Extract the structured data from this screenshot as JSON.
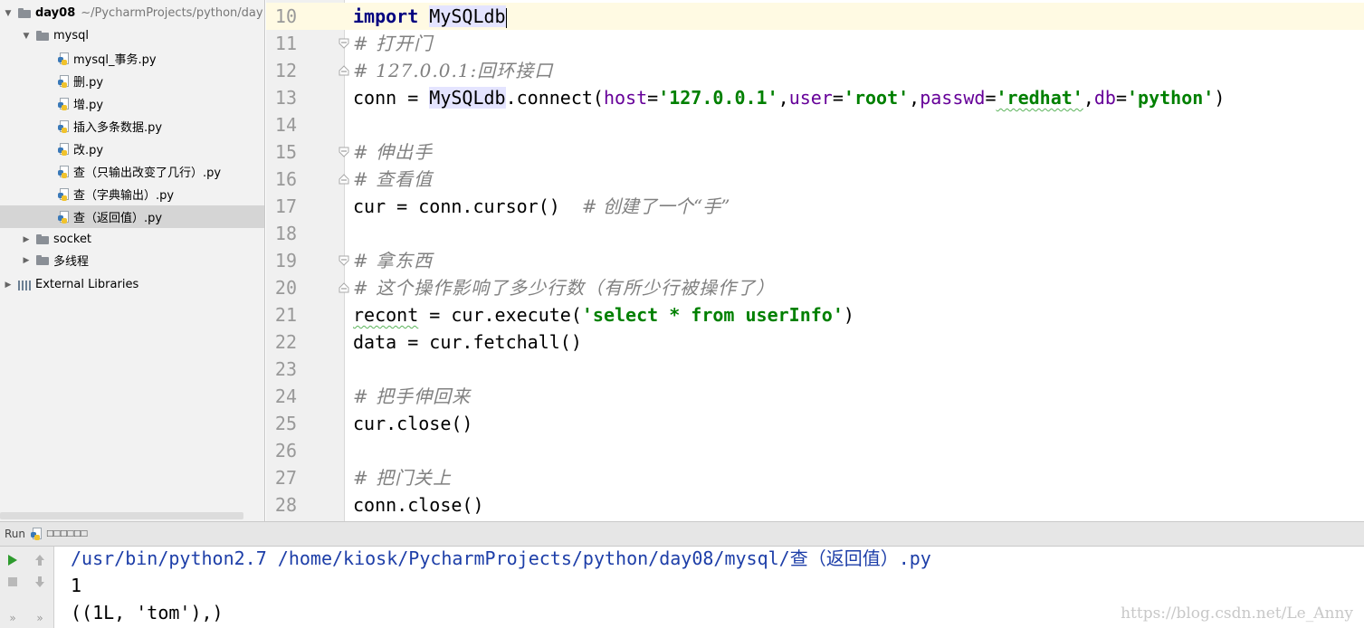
{
  "project_tree": {
    "root": {
      "name": "day08",
      "path": "~/PycharmProjects/python/day"
    },
    "folder_mysql": "mysql",
    "files": [
      "mysql_事务.py",
      "删.py",
      "增.py",
      "插入多条数据.py",
      "改.py",
      "查（只输出改变了几行）.py",
      "查（字典输出）.py",
      "查（返回值）.py"
    ],
    "selected_file": "查（返回值）.py",
    "folder_socket": "socket",
    "folder_threads": "多线程",
    "external_libraries": "External Libraries"
  },
  "editor": {
    "line_numbers": [
      "10",
      "11",
      "12",
      "13",
      "14",
      "15",
      "16",
      "17",
      "18",
      "19",
      "20",
      "21",
      "22",
      "23",
      "24",
      "25",
      "26",
      "27",
      "28"
    ],
    "l10": {
      "kw": "import",
      "cls": "MySQLdb"
    },
    "l11": "# 打开门",
    "l12": "# 127.0.0.1:回环接口",
    "l13": {
      "lhs": "conn = ",
      "cls": "MySQLdb",
      "call": ".connect(",
      "p1": "host",
      "v1": "'127.0.0.1'",
      "p2": "user",
      "v2": "'root'",
      "p3": "passwd",
      "v3": "'redhat'",
      "p4": "db",
      "v4": "'python'",
      "close": ")"
    },
    "l15": "# 伸出手",
    "l16": "# 查看值",
    "l17": {
      "code": "cur = conn.cursor()  ",
      "comment": "# 创建了一个“手”"
    },
    "l19": "# 拿东西",
    "l20": "# 这个操作影响了多少行数（有所少行被操作了）",
    "l21": {
      "var": "recont",
      "mid": " = cur.execute(",
      "str": "'select * from userInfo'",
      "end": ")"
    },
    "l22": "data = cur.fetchall()",
    "l24": "# 把手伸回来",
    "l25": "cur.close()",
    "l27": "# 把门关上",
    "l28": "conn.close()"
  },
  "run_panel": {
    "label": "Run",
    "config_name": "□□□□□□",
    "console": [
      "/usr/bin/python2.7 /home/kiosk/PycharmProjects/python/day08/mysql/查（返回值）.py",
      "1",
      "((1L, 'tom'),)"
    ]
  },
  "watermark": "https://blog.csdn.net/Le_Anny"
}
